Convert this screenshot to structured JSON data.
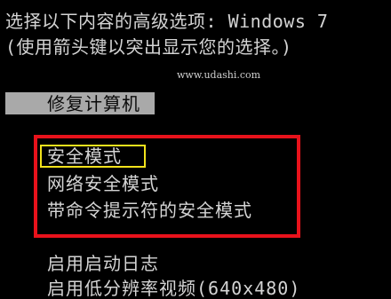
{
  "header": {
    "line1": "选择以下内容的高级选项: Windows 7",
    "line2": "(使用箭头键以突出显示您的选择。)"
  },
  "watermark": "www.udashi.com",
  "menu": {
    "items": [
      {
        "label": "修复计算机",
        "selected": true
      },
      {
        "label": "安全模式",
        "highlighted": true
      },
      {
        "label": "网络安全模式"
      },
      {
        "label": "带命令提示符的安全模式"
      },
      {
        "label": "启用启动日志"
      },
      {
        "label": "启用低分辨率视频(640x480)"
      }
    ]
  },
  "colors": {
    "background": "#000000",
    "text": "#d4d4d4",
    "selection_bar": "#a9a9a9",
    "annotation_red": "#e8121b",
    "annotation_yellow": "#f2e21c"
  }
}
